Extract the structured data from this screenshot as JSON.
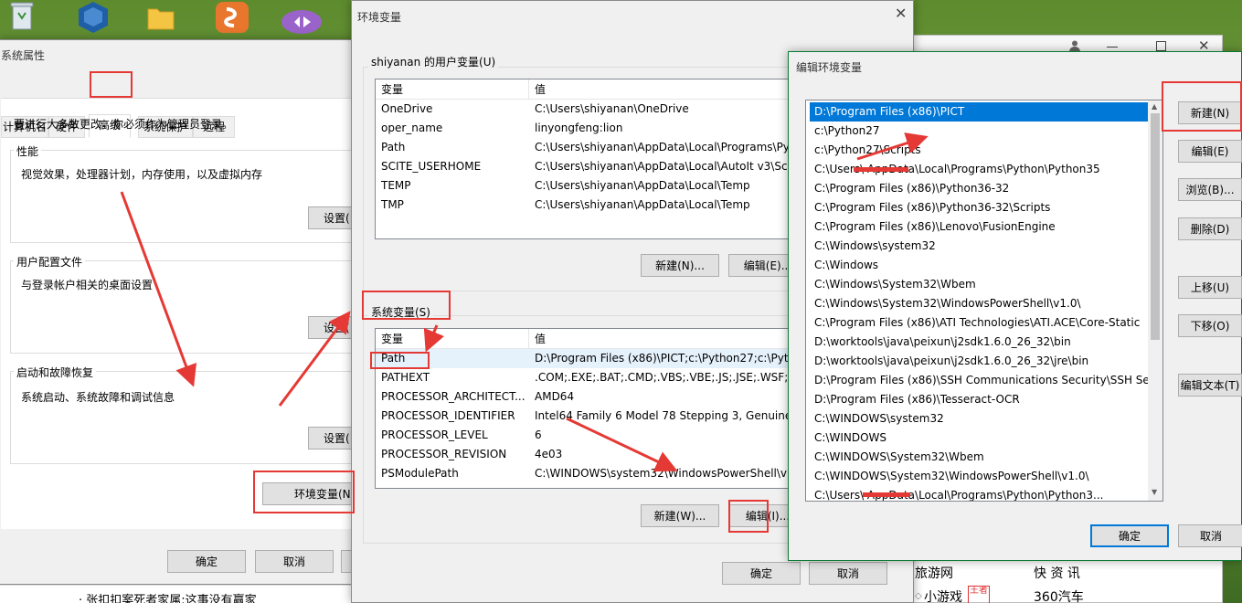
{
  "taskbar": {
    "icons": [
      "recycle-bin-icon",
      "virtualbox-icon",
      "folder-icon",
      "pycharm-icon",
      "visual-studio-icon"
    ]
  },
  "sys_props": {
    "title": "系统属性",
    "tabs": [
      "计算机名",
      "硬件",
      "高级",
      "系统保护",
      "远程"
    ],
    "active_tab": "高级",
    "admin_note": "要进行大多数更改，你必须作为管理员登录。",
    "perf": {
      "label": "性能",
      "desc": "视觉效果，处理器计划，内存使用，以及虚拟内存",
      "button": "设置("
    },
    "profile": {
      "label": "用户配置文件",
      "desc": "与登录帐户相关的桌面设置",
      "button": "设置("
    },
    "startup": {
      "label": "启动和故障恢复",
      "desc": "系统启动、系统故障和调试信息",
      "button": "设置("
    },
    "env_button": "环境变量(N",
    "ok": "确定",
    "cancel": "取消"
  },
  "env_dialog": {
    "title": "环境变量",
    "user_group": "shiyanan 的用户变量(U)",
    "col_var": "变量",
    "col_val": "值",
    "user_vars": [
      {
        "name": "OneDrive",
        "value": "C:\\Users\\shiyanan\\OneDrive"
      },
      {
        "name": "oper_name",
        "value": "linyongfeng:lion"
      },
      {
        "name": "Path",
        "value": "C:\\Users\\shiyanan\\AppData\\Local\\Programs\\Pyt"
      },
      {
        "name": "SCITE_USERHOME",
        "value": "C:\\Users\\shiyanan\\AppData\\Local\\AutoIt v3\\SciT"
      },
      {
        "name": "TEMP",
        "value": "C:\\Users\\shiyanan\\AppData\\Local\\Temp"
      },
      {
        "name": "TMP",
        "value": "C:\\Users\\shiyanan\\AppData\\Local\\Temp"
      }
    ],
    "user_new": "新建(N)...",
    "user_edit": "编辑(E)...",
    "sys_group": "系统变量(S)",
    "sys_vars": [
      {
        "name": "Path",
        "value": "D:\\Program Files (x86)\\PICT;c:\\Python27;c:\\Pytho"
      },
      {
        "name": "PATHEXT",
        "value": ".COM;.EXE;.BAT;.CMD;.VBS;.VBE;.JS;.JSE;.WSF;.WS"
      },
      {
        "name": "PROCESSOR_ARCHITECT...",
        "value": "AMD64"
      },
      {
        "name": "PROCESSOR_IDENTIFIER",
        "value": "Intel64 Family 6 Model 78 Stepping 3, GenuineIn"
      },
      {
        "name": "PROCESSOR_LEVEL",
        "value": "6"
      },
      {
        "name": "PROCESSOR_REVISION",
        "value": "4e03"
      },
      {
        "name": "PSModulePath",
        "value": "C:\\WINDOWS\\system32\\WindowsPowerShell\\v1"
      }
    ],
    "sys_new": "新建(W)...",
    "sys_edit": "编辑(I)...",
    "ok": "确定",
    "cancel": "取消"
  },
  "edit_dialog": {
    "title": "编辑环境变量",
    "paths": [
      "D:\\Program Files (x86)\\PICT",
      "c:\\Python27",
      "c:\\Python27\\Scripts",
      "C:\\Users\\        AppData\\Local\\Programs\\Python\\Python35",
      "C:\\Program Files (x86)\\Python36-32",
      "C:\\Program Files (x86)\\Python36-32\\Scripts",
      "C:\\Program Files (x86)\\Lenovo\\FusionEngine",
      "C:\\Windows\\system32",
      "C:\\Windows",
      "C:\\Windows\\System32\\Wbem",
      "C:\\Windows\\System32\\WindowsPowerShell\\v1.0\\",
      "C:\\Program Files (x86)\\ATI Technologies\\ATI.ACE\\Core-Static",
      "D:\\worktools\\java\\peixun\\j2sdk1.6.0_26_32\\bin",
      "D:\\worktools\\java\\peixun\\j2sdk1.6.0_26_32\\jre\\bin",
      "D:\\Program Files (x86)\\SSH Communications Security\\SSH Se...",
      "D:\\Program Files (x86)\\Tesseract-OCR",
      "C:\\WINDOWS\\system32",
      "C:\\WINDOWS",
      "C:\\WINDOWS\\System32\\Wbem",
      "C:\\WINDOWS\\System32\\WindowsPowerShell\\v1.0\\",
      "C:\\Users\\          AppData\\Local\\Programs\\Python\\Python3..."
    ],
    "btn_new": "新建(N)",
    "btn_edit": "编辑(E)",
    "btn_browse": "浏览(B)...",
    "btn_delete": "删除(D)",
    "btn_up": "上移(U)",
    "btn_down": "下移(O)",
    "btn_edit_text": "编辑文本(T)",
    "ok": "确定",
    "cancel": "取消"
  },
  "browser": {
    "links": [
      {
        "a": "旅游网",
        "b": "快 资 讯"
      },
      {
        "a": "小游戏",
        "b": "360汽车"
      }
    ],
    "badge": "王者",
    "news": "· 张扣扣案死者家属:这事没有赢家"
  }
}
